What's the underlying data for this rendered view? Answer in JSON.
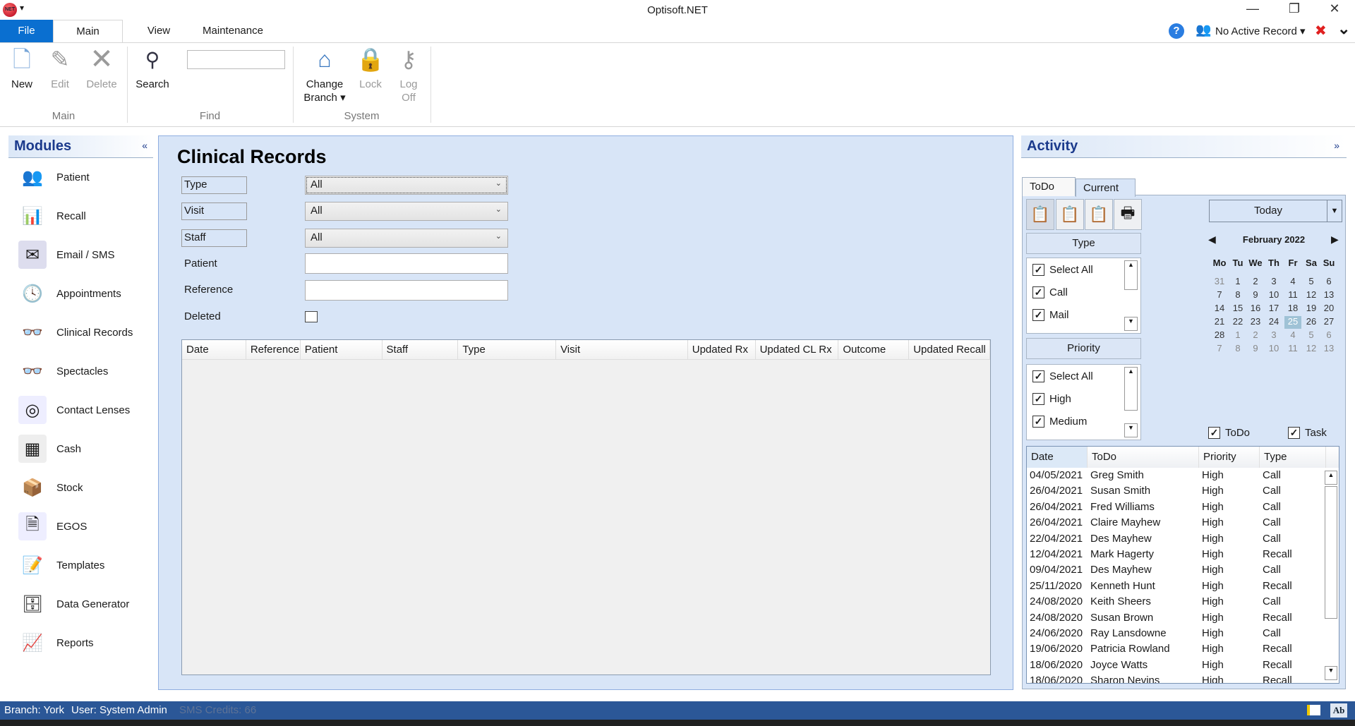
{
  "window": {
    "title": "Optisoft.NET",
    "logo_text": "NET",
    "min": "—",
    "restore": "❐",
    "close": "✕"
  },
  "tabs": [
    {
      "label": "File"
    },
    {
      "label": "Main"
    },
    {
      "label": "View"
    },
    {
      "label": "Maintenance"
    }
  ],
  "topright": {
    "help": "?",
    "record": "No Active Record ▾",
    "close": "✖",
    "collapse": "⌄"
  },
  "ribbon": {
    "new": "New",
    "edit": "Edit",
    "delete": "Delete",
    "search": "Search",
    "search_value": "",
    "change": "Change",
    "branch": "Branch ▾",
    "lock": "Lock",
    "log": "Log",
    "off": "Off",
    "groups": [
      "Main",
      "Find",
      "System"
    ]
  },
  "modules": {
    "title": "Modules",
    "collapse": "«",
    "items": [
      "Patient",
      "Recall",
      "Email / SMS",
      "Appointments",
      "Clinical Records",
      "Spectacles",
      "Contact Lenses",
      "Cash",
      "Stock",
      "EGOS",
      "Templates",
      "Data Generator",
      "Reports"
    ]
  },
  "clinical": {
    "title": "Clinical Records",
    "type_label": "Type",
    "type_value": "All",
    "visit_label": "Visit",
    "visit_value": "All",
    "staff_label": "Staff",
    "staff_value": "All",
    "patient_label": "Patient",
    "reference_label": "Reference",
    "deleted_label": "Deleted",
    "columns": [
      "Date",
      "Reference",
      "Patient",
      "Staff",
      "Type",
      "Visit",
      "Updated Rx",
      "Updated CL Rx",
      "Outcome",
      "Updated Recall"
    ]
  },
  "activity": {
    "title": "Activity",
    "expand": "»",
    "tabs": [
      "ToDo",
      "Current"
    ],
    "type_header": "Type",
    "type_items": [
      "Select All",
      "Call",
      "Mail"
    ],
    "priority_header": "Priority",
    "priority_items": [
      "Select All",
      "High",
      "Medium"
    ],
    "today": "Today",
    "month": "February 2022",
    "weekdays": [
      "Mo",
      "Tu",
      "We",
      "Th",
      "Fr",
      "Sa",
      "Su"
    ],
    "days": [
      [
        "31",
        "1",
        "2",
        "3",
        "4",
        "5",
        "6"
      ],
      [
        "7",
        "8",
        "9",
        "10",
        "11",
        "12",
        "13"
      ],
      [
        "14",
        "15",
        "16",
        "17",
        "18",
        "19",
        "20"
      ],
      [
        "21",
        "22",
        "23",
        "24",
        "25",
        "26",
        "27"
      ],
      [
        "28",
        "1",
        "2",
        "3",
        "4",
        "5",
        "6"
      ],
      [
        "7",
        "8",
        "9",
        "10",
        "11",
        "12",
        "13"
      ]
    ],
    "selected_day": "25",
    "todo_check": "ToDo",
    "task_check": "Task",
    "grid_columns": [
      "Date",
      "ToDo",
      "Priority",
      "Type"
    ],
    "rows": [
      [
        "04/05/2021",
        "Greg Smith",
        "High",
        "Call"
      ],
      [
        "26/04/2021",
        "Susan Smith",
        "High",
        "Call"
      ],
      [
        "26/04/2021",
        "Fred Williams",
        "High",
        "Call"
      ],
      [
        "26/04/2021",
        "Claire Mayhew",
        "High",
        "Call"
      ],
      [
        "22/04/2021",
        "Des Mayhew",
        "High",
        "Call"
      ],
      [
        "12/04/2021",
        "Mark Hagerty",
        "High",
        "Recall"
      ],
      [
        "09/04/2021",
        "Des Mayhew",
        "High",
        "Call"
      ],
      [
        "25/11/2020",
        "Kenneth Hunt",
        "High",
        "Recall"
      ],
      [
        "24/08/2020",
        "Keith Sheers",
        "High",
        "Call"
      ],
      [
        "24/08/2020",
        "Susan Brown",
        "High",
        "Recall"
      ],
      [
        "24/06/2020",
        "Ray Lansdowne",
        "High",
        "Call"
      ],
      [
        "19/06/2020",
        "Patricia Rowland",
        "High",
        "Recall"
      ],
      [
        "18/06/2020",
        "Joyce Watts",
        "High",
        "Recall"
      ],
      [
        "18/06/2020",
        "Sharon Nevins",
        "High",
        "Recall"
      ]
    ]
  },
  "status": {
    "branch": "Branch: York",
    "user": "User: System Admin",
    "sms": "SMS Credits: 66",
    "ab": "Ab"
  },
  "colors": {
    "accent": "#0a6fd0",
    "status_bar": "#2b5797",
    "panel": "#d8e5f7",
    "heading": "#1b3a8c"
  }
}
